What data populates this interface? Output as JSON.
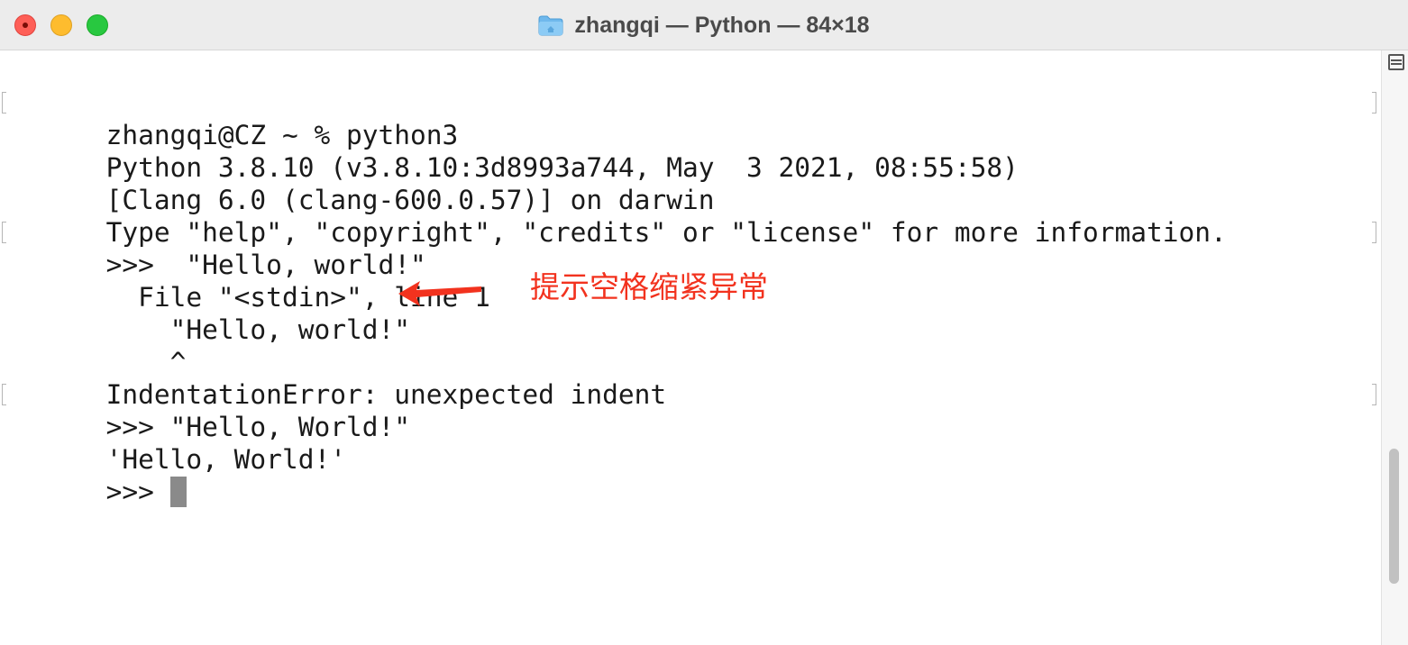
{
  "window": {
    "title": "zhangqi — Python — 84×18"
  },
  "terminal": {
    "lines": [
      "zhangqi@CZ ~ % python3",
      "Python 3.8.10 (v3.8.10:3d8993a744, May  3 2021, 08:55:58)",
      "[Clang 6.0 (clang-600.0.57)] on darwin",
      "Type \"help\", \"copyright\", \"credits\" or \"license\" for more information.",
      ">>>  \"Hello, world!\"",
      "  File \"<stdin>\", line 1",
      "    \"Hello, world!\"",
      "    ^",
      "IndentationError: unexpected indent",
      ">>> \"Hello, World!\"",
      "'Hello, World!'",
      ">>> "
    ]
  },
  "annotation": {
    "text": "提示空格缩紧异常",
    "color": "#f2321e"
  },
  "colors": {
    "close": "#fe5f57",
    "minimize": "#febc2e",
    "zoom": "#28c840"
  },
  "icons": {
    "title": "folder-icon",
    "scrollbar_top": "split-pane-icon"
  }
}
